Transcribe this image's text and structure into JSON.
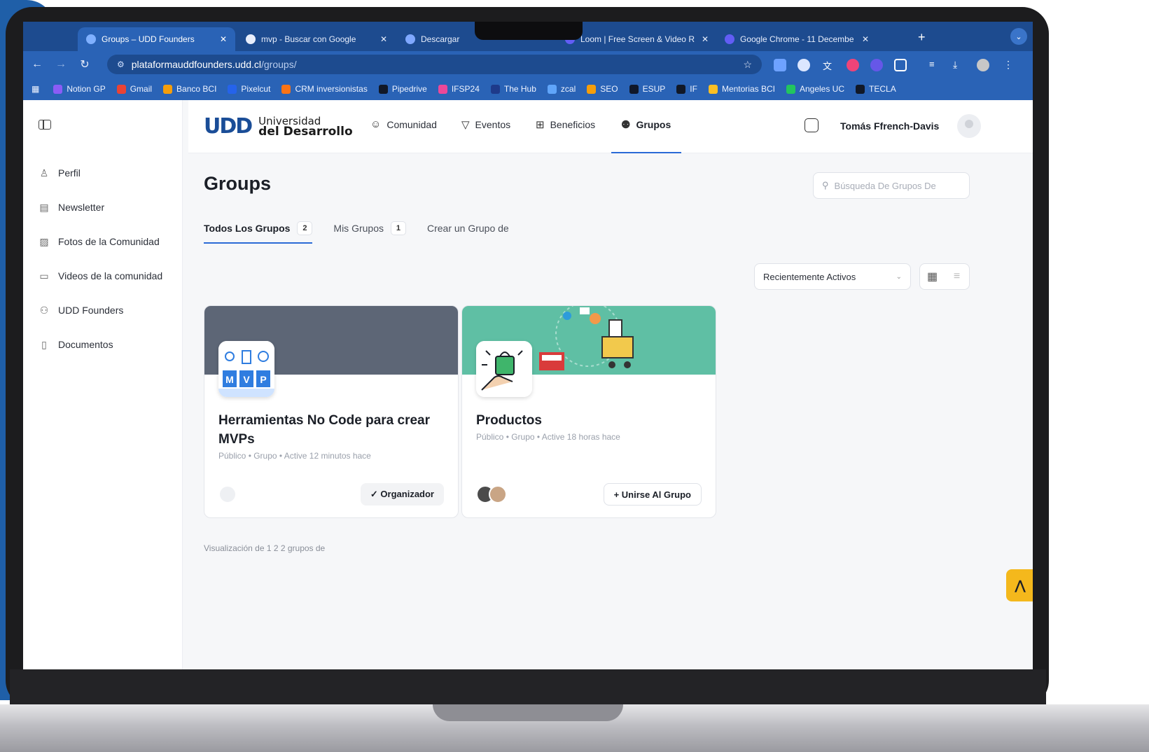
{
  "browser": {
    "tabs": [
      {
        "title": "Groups – UDD Founders",
        "active": true
      },
      {
        "title": "mvp - Buscar con Google",
        "active": false
      },
      {
        "title": "Descargar",
        "active": false
      },
      {
        "title": "Loom | Free Screen & Video R",
        "active": false
      },
      {
        "title": "Google Chrome - 11 Decembe",
        "active": false
      }
    ],
    "new_tab": "+",
    "url_host": "plataformauddfounders.udd.cl",
    "url_path": "/groups/",
    "bookmarks": [
      {
        "label": "Notion GP",
        "color": "#8b5cf6"
      },
      {
        "label": "Gmail",
        "color": "#ea4335"
      },
      {
        "label": "Banco BCI",
        "color": "#f59e0b"
      },
      {
        "label": "Pixelcut",
        "color": "#2563eb"
      },
      {
        "label": "CRM inversionistas",
        "color": "#f97316"
      },
      {
        "label": "Pipedrive",
        "color": "#111827"
      },
      {
        "label": "IFSP24",
        "color": "#ec4899"
      },
      {
        "label": "The Hub",
        "color": "#1e3a8a"
      },
      {
        "label": "zcal",
        "color": "#60a5fa"
      },
      {
        "label": "SEO",
        "color": "#f59e0b"
      },
      {
        "label": "ESUP",
        "color": "#0f172a"
      },
      {
        "label": "IF",
        "color": "#111827"
      },
      {
        "label": "Mentorias BCI",
        "color": "#fbbf24"
      },
      {
        "label": "Angeles UC",
        "color": "#22c55e"
      },
      {
        "label": "TECLA",
        "color": "#111827"
      }
    ]
  },
  "sidebar": {
    "items": [
      {
        "label": "Perfil",
        "icon": "user-icon"
      },
      {
        "label": "Newsletter",
        "icon": "newsletter-icon"
      },
      {
        "label": "Fotos de la Comunidad",
        "icon": "photos-icon"
      },
      {
        "label": "Videos de la comunidad",
        "icon": "video-icon"
      },
      {
        "label": "UDD Founders",
        "icon": "members-icon"
      },
      {
        "label": "Documentos",
        "icon": "document-icon"
      }
    ]
  },
  "header": {
    "logo_mark": "UDD",
    "logo_line1": "Universidad",
    "logo_line2": "del Desarrollo",
    "nav": [
      {
        "label": "Comunidad",
        "icon": "smiley-icon"
      },
      {
        "label": "Eventos",
        "icon": "funnel-icon"
      },
      {
        "label": "Beneficios",
        "icon": "gift-icon"
      },
      {
        "label": "Grupos",
        "icon": "groups-icon",
        "active": true
      }
    ],
    "user_name": "Tomás Ffrench-Davis"
  },
  "main": {
    "title": "Groups",
    "search_placeholder": "Búsqueda De Grupos De",
    "tabs": [
      {
        "label": "Todos Los Grupos",
        "count": "2",
        "active": true
      },
      {
        "label": "Mis Grupos",
        "count": "1"
      },
      {
        "label": "Crear un Grupo de"
      }
    ],
    "sort_value": "Recientemente Activos",
    "groups": [
      {
        "title": "Herramientas No Code para crear MVPs",
        "meta": "Público • Grupo • Active 12 minutos hace",
        "action": "✓ Organizador",
        "cover_color": "#5d6676"
      },
      {
        "title": "Productos",
        "meta": "Público • Grupo • Active 18 horas hace",
        "action": "+ Unirse Al Grupo",
        "cover_color": "#5fbfa4"
      }
    ],
    "results_text": "Visualización de 1 2 2 grupos de"
  },
  "colors": {
    "accent": "#2b6ad6",
    "brand": "#1a4d97",
    "chrome": "#2a63b6",
    "help_fab": "#f4b81c"
  }
}
